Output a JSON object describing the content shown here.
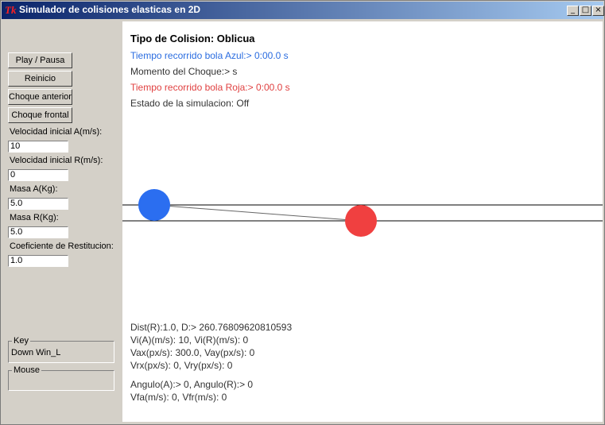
{
  "window": {
    "title": "Simulador de colisiones elasticas en 2D",
    "logo": "Tk"
  },
  "controls": {
    "play_pause": "Play / Pausa",
    "reset": "Reinicio",
    "prev_collision": "Choque anterior",
    "head_on": "Choque frontal"
  },
  "fields": [
    {
      "label": "Velocidad inicial A(m/s):",
      "value": "10"
    },
    {
      "label": "Velocidad inicial R(m/s):",
      "value": "0"
    },
    {
      "label": "Masa A(Kg):",
      "value": "5.0"
    },
    {
      "label": "Masa R(Kg):",
      "value": "5.0"
    },
    {
      "label": "Coeficiente de Restitucion:",
      "value": "1.0"
    }
  ],
  "key_box": {
    "label": "Key",
    "value": "Down Win_L"
  },
  "mouse_box": {
    "label": "Mouse",
    "value": ""
  },
  "canvas": {
    "title": "Tipo de Colision: Oblicua",
    "time_blue": "Tiempo recorrido bola Azul:> 0:00.0 s",
    "impact_moment": "Momento del Choque:>  s",
    "time_red": "Tiempo recorrido bola Roja:> 0:00.0 s",
    "sim_state": "Estado de la simulacion: Off",
    "info": [
      "Dist(R):1.0, D:> 260.76809620810593",
      "Vi(A)(m/s): 10, Vi(R)(m/s): 0",
      "Vax(px/s): 300.0, Vay(px/s): 0",
      "Vrx(px/s): 0, Vry(px/s): 0",
      "Angulo(A):> 0, Angulo(R):> 0",
      "Vfa(m/s): 0, Vfr(m/s): 0"
    ]
  },
  "colors": {
    "ball_a": "#2b6ef0",
    "ball_r": "#f04040",
    "titlebar": "#0a246a"
  }
}
